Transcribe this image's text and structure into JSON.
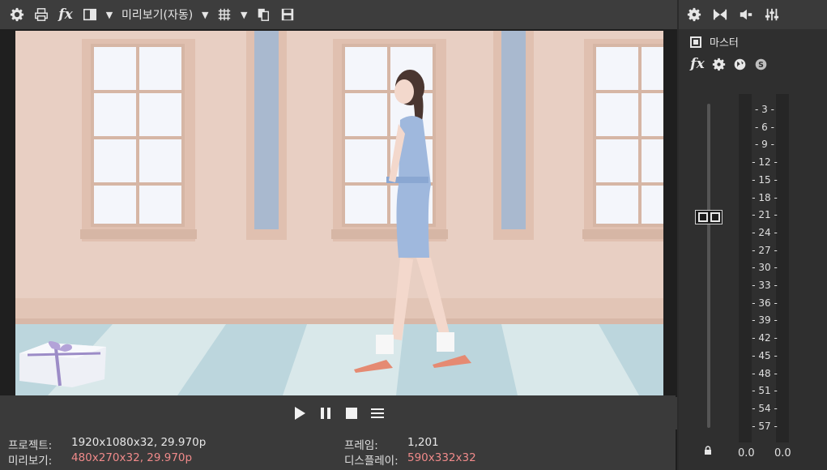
{
  "toolbar": {
    "preview_quality_label": "미리보기(자동)",
    "icons": [
      "gear-icon",
      "print-icon",
      "fx-icon",
      "split-screen-icon",
      "dropdown-icon",
      "quality-dropdown-icon",
      "grid-icon",
      "grid-dropdown-icon",
      "copy-snapshot-icon",
      "save-snapshot-icon"
    ]
  },
  "fx_label": "fx",
  "transport": {
    "icons": [
      "play-icon",
      "pause-icon",
      "stop-icon",
      "menu-icon"
    ]
  },
  "info": {
    "project_label": "프로젝트:",
    "project_value": "1920x1080x32, 29.970p",
    "preview_label": "미리보기:",
    "preview_value": "480x270x32, 29.970p",
    "frame_label": "프레임:",
    "frame_value": "1,201",
    "display_label": "디스플레이:",
    "display_value": "590x332x32"
  },
  "master": {
    "title": "마스터",
    "toolbar_icons": [
      "gear-icon",
      "bowtie-icon",
      "volume-icon",
      "mixer-icon"
    ],
    "fx_icons": [
      "fx-icon",
      "gear-icon",
      "globe-icon",
      "s-plugin-icon"
    ],
    "scale": [
      "3",
      "6",
      "9",
      "12",
      "15",
      "18",
      "21",
      "24",
      "27",
      "30",
      "33",
      "36",
      "39",
      "42",
      "45",
      "48",
      "51",
      "54",
      "57"
    ],
    "peak_left": "0.0",
    "peak_right": "0.0"
  },
  "colors": {
    "accent_text": "#f08a8a",
    "background": "#3a3a3a",
    "wall": "#e9d2c6",
    "floor": "#b9d7dc"
  }
}
